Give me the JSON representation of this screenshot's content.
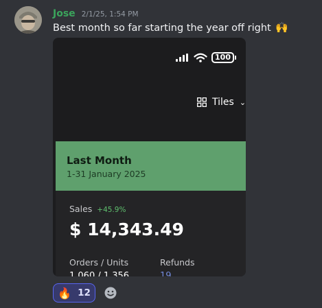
{
  "message": {
    "author": "Jose",
    "timestamp": "2/1/25, 1:54 PM",
    "text": "Best month so far starting the year off right",
    "emoji": "🙌"
  },
  "attachment": {
    "battery": "100",
    "view_toggle": "Tiles",
    "banner": {
      "title": "Last Month",
      "subtitle": "1-31 January 2025"
    },
    "sales": {
      "label": "Sales",
      "change": "+45.9%",
      "value": "$ 14,343.49"
    },
    "orders_label": "Orders / Units",
    "orders_value": "1,060 / 1,356",
    "refunds_label": "Refunds",
    "refunds_value": "19"
  },
  "reactions": [
    {
      "emoji": "🔥",
      "count": "12"
    }
  ],
  "colors": {
    "background": "#313338",
    "username": "#3ba55c",
    "banner": "#5fa06d",
    "reaction_border": "#5865f2"
  },
  "icons": [
    "avatar",
    "cellular-signal-icon",
    "wifi-icon",
    "battery-icon",
    "grid-icon",
    "chevron-down-icon",
    "add-reaction-icon"
  ]
}
